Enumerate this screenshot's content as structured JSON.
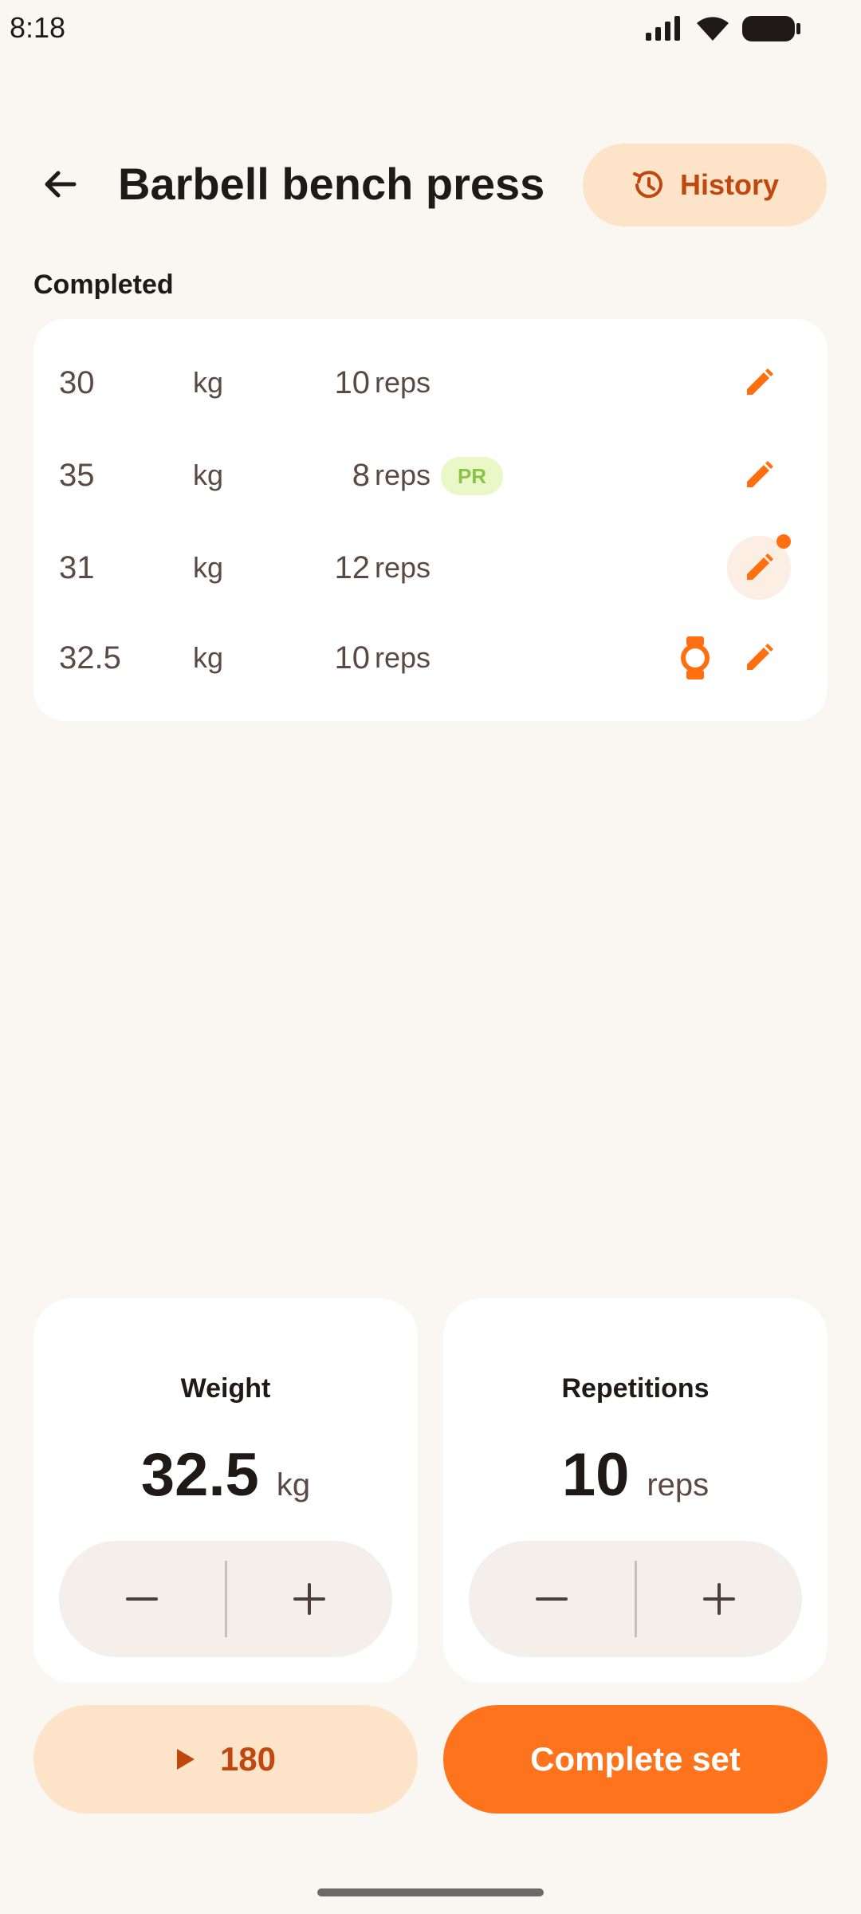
{
  "status_bar": {
    "time": "8:18"
  },
  "header": {
    "title": "Barbell bench press",
    "history_label": "History"
  },
  "completed": {
    "label": "Completed",
    "sets": [
      {
        "weight": "30",
        "weight_unit": "kg",
        "reps": "10",
        "reps_unit": "reps",
        "pr": false
      },
      {
        "weight": "35",
        "weight_unit": "kg",
        "reps": "8",
        "reps_unit": "reps",
        "pr": true,
        "pr_label": "PR"
      },
      {
        "weight": "31",
        "weight_unit": "kg",
        "reps": "12",
        "reps_unit": "reps",
        "pr": false
      },
      {
        "weight": "32.5",
        "weight_unit": "kg",
        "reps": "10",
        "reps_unit": "reps",
        "pr": false
      }
    ]
  },
  "weight_card": {
    "label": "Weight",
    "value": "32.5",
    "unit": "kg"
  },
  "reps_card": {
    "label": "Repetitions",
    "value": "10",
    "unit": "reps"
  },
  "timer": {
    "label": "180"
  },
  "complete_button": {
    "label": "Complete set"
  },
  "colors": {
    "accent": "#FF731C",
    "accent_soft": "#FDE3C8",
    "accent_text": "#C0480E",
    "pr_bg": "#E9F8C6",
    "pr_text": "#8BC34A",
    "background": "#FAF6F2"
  },
  "icons": [
    "signal-icon",
    "wifi-icon",
    "battery-icon",
    "back-arrow-icon",
    "history-icon",
    "edit-icon",
    "watch-icon",
    "minus-icon",
    "plus-icon",
    "play-icon"
  ]
}
